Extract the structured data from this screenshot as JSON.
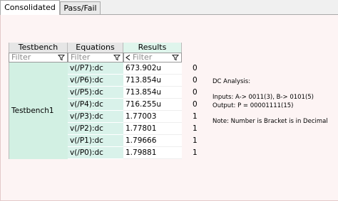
{
  "tabs": [
    {
      "label": "Consolidated",
      "active": true
    },
    {
      "label": "Pass/Fail",
      "active": false
    }
  ],
  "table": {
    "headers": [
      "Testbench",
      "Equations",
      "Results"
    ],
    "filter_placeholder": "Filter",
    "testbench_name": "Testbench1",
    "rows": [
      {
        "equation": "v(/P7):dc",
        "result": "673.902u",
        "digital": "0"
      },
      {
        "equation": "v(/P6):dc",
        "result": "713.854u",
        "digital": "0"
      },
      {
        "equation": "v(/P5):dc",
        "result": "713.854u",
        "digital": "0"
      },
      {
        "equation": "v(/P4):dc",
        "result": "716.255u",
        "digital": "0"
      },
      {
        "equation": "v(/P3):dc",
        "result": "1.77003",
        "digital": "1"
      },
      {
        "equation": "v(/P2):dc",
        "result": "1.77801",
        "digital": "1"
      },
      {
        "equation": "v(/P1):dc",
        "result": "1.79666",
        "digital": "1"
      },
      {
        "equation": "v(/P0):dc",
        "result": "1.79881",
        "digital": "1"
      }
    ]
  },
  "notes": [
    "DC Analysis:",
    "",
    "Inputs: A-> 0011(3), B-> 0101(5)",
    "Output: P = 00001111(15)",
    "",
    "Note: Number is Bracket is in Decimal"
  ],
  "colors": {
    "header_bg": "#e6e6e6",
    "results_header_bg": "#dff5ec",
    "testbench_cell_bg": "#d2f0e3",
    "equation_cell_bg": "#d9f2ea",
    "panel_bg": "#fdf4f4"
  },
  "icons": {
    "filter": "funnel-icon",
    "sort_indicator": "chevron-left-icon"
  }
}
